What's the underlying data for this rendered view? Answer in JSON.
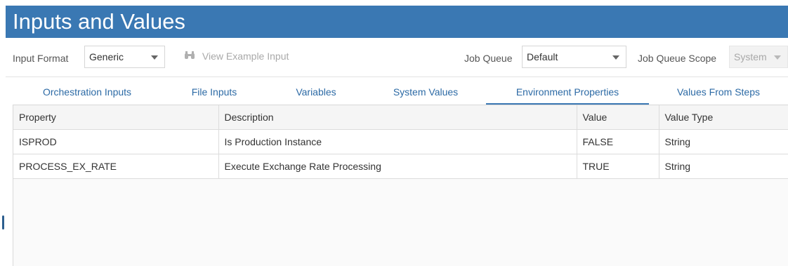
{
  "title": "Inputs and Values",
  "toolbar": {
    "input_format_label": "Input Format",
    "input_format_value": "Generic",
    "view_example_label": "View Example Input",
    "job_queue_label": "Job Queue",
    "job_queue_value": "Default",
    "job_queue_scope_label": "Job Queue Scope",
    "job_queue_scope_value": "System"
  },
  "tabs": [
    {
      "label": "Orchestration Inputs",
      "active": false
    },
    {
      "label": "File Inputs",
      "active": false
    },
    {
      "label": "Variables",
      "active": false
    },
    {
      "label": "System Values",
      "active": false
    },
    {
      "label": "Environment Properties",
      "active": true
    },
    {
      "label": "Values From Steps",
      "active": false
    }
  ],
  "table": {
    "columns": [
      "Property",
      "Description",
      "Value",
      "Value Type"
    ],
    "rows": [
      [
        "ISPROD",
        "Is Production Instance",
        "FALSE",
        "String"
      ],
      [
        "PROCESS_EX_RATE",
        "Execute Exchange Rate Processing",
        "TRUE",
        "String"
      ]
    ]
  },
  "icons": {
    "view_example": "binoculars-icon",
    "dropdown": "chevron-down-icon"
  },
  "colors": {
    "title_bar": "#3a78b3",
    "tab_text": "#2c6aa5",
    "active_tab_underline": "#3a78b3"
  }
}
